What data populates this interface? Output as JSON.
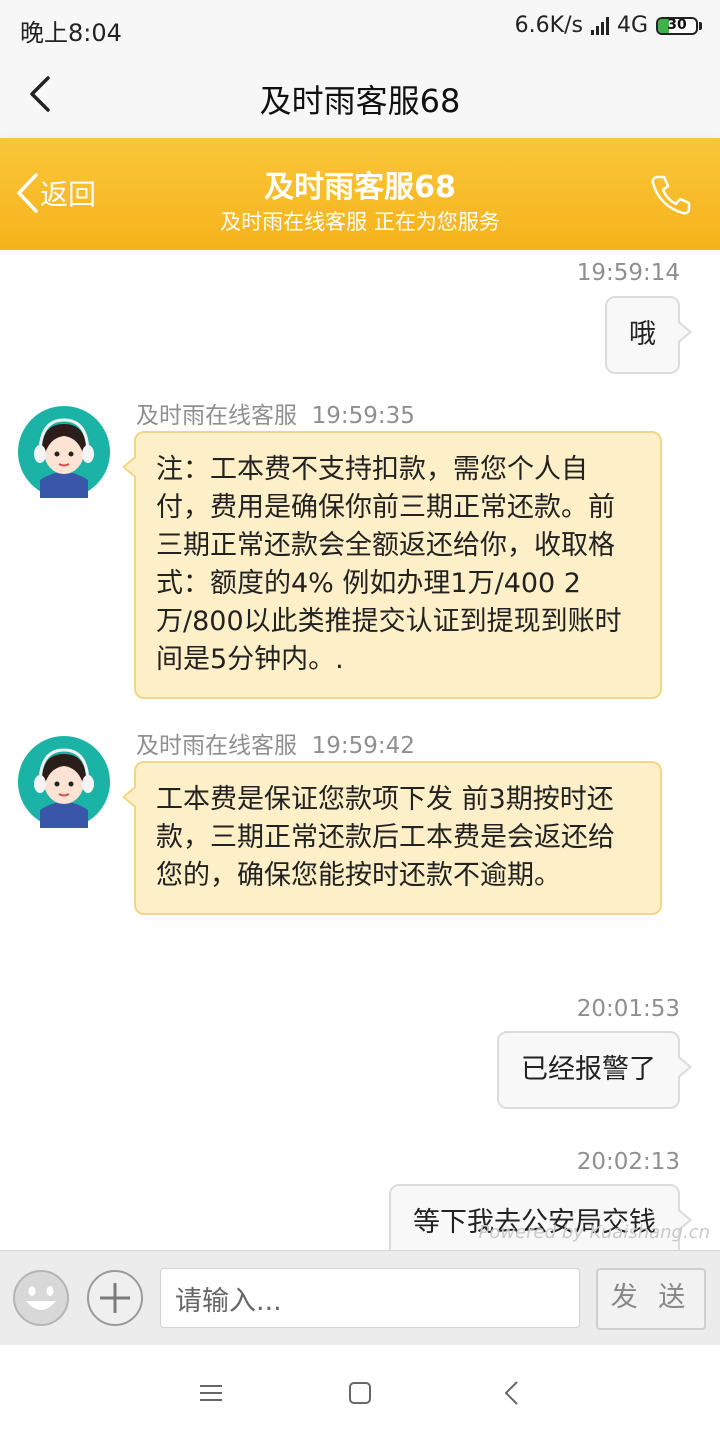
{
  "status_bar": {
    "time": "晚上8:04",
    "network_speed": "6.6K/s",
    "network_type": "4G",
    "battery_level": "30"
  },
  "app_bar": {
    "title": "及时雨客服68"
  },
  "chat_header": {
    "back_label": "返回",
    "title": "及时雨客服68",
    "subtitle": "及时雨在线客服 正在为您服务"
  },
  "messages": [
    {
      "direction": "out",
      "time": "19:59:14",
      "text": "哦"
    },
    {
      "direction": "in",
      "sender": "及时雨在线客服",
      "time": "19:59:35",
      "text": "注：工本费不支持扣款，需您个人自付，费用是确保你前三期正常还款。前三期正常还款会全额返还给你，收取格式：额度的4% 例如办理1万/400  2万/800以此类推提交认证到提现到账时间是5分钟内。."
    },
    {
      "direction": "in",
      "sender": "及时雨在线客服",
      "time": "19:59:42",
      "text": "工本费是保证您款项下发 前3期按时还款，三期正常还款后工本费是会返还给您的，确保您能按时还款不逾期。"
    },
    {
      "direction": "out",
      "time": "20:01:53",
      "text": "已经报警了"
    },
    {
      "direction": "out",
      "time": "20:02:13",
      "text": "等下我去公安局交钱"
    }
  ],
  "watermark": "Powered by Kuaishang.cn",
  "input_bar": {
    "placeholder": "请输入...",
    "send_label": "发 送"
  },
  "colors": {
    "header": "#f7b723",
    "incoming_bubble": "#fdefc7",
    "outgoing_bubble": "#f8f8f8"
  }
}
